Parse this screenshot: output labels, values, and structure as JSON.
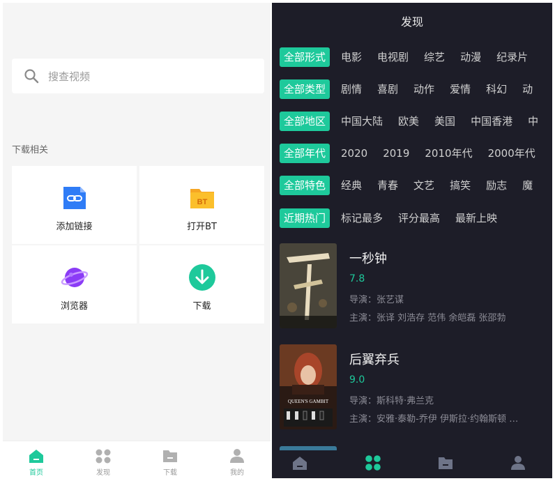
{
  "left": {
    "search": {
      "placeholder": "搜查视频"
    },
    "section_title": "下载相关",
    "tools": [
      {
        "label": "添加链接",
        "icon": "link-icon"
      },
      {
        "label": "打开BT",
        "icon": "bt-folder-icon"
      },
      {
        "label": "浏览器",
        "icon": "planet-icon"
      },
      {
        "label": "下载",
        "icon": "download-icon"
      }
    ],
    "tabs": [
      {
        "label": "首页",
        "icon": "home-icon",
        "active": true
      },
      {
        "label": "发现",
        "icon": "grid-icon",
        "active": false
      },
      {
        "label": "下载",
        "icon": "folder-icon",
        "active": false
      },
      {
        "label": "我的",
        "icon": "user-icon",
        "active": false
      }
    ],
    "accent": "#1ec99b"
  },
  "right": {
    "title": "发现",
    "filters": [
      {
        "selected": "全部形式",
        "options": [
          "电影",
          "电视剧",
          "综艺",
          "动漫",
          "纪录片"
        ]
      },
      {
        "selected": "全部类型",
        "options": [
          "剧情",
          "喜剧",
          "动作",
          "爱情",
          "科幻",
          "动"
        ]
      },
      {
        "selected": "全部地区",
        "options": [
          "中国大陆",
          "欧美",
          "美国",
          "中国香港",
          "中"
        ]
      },
      {
        "selected": "全部年代",
        "options": [
          "2020",
          "2019",
          "2010年代",
          "2000年代"
        ]
      },
      {
        "selected": "全部特色",
        "options": [
          "经典",
          "青春",
          "文艺",
          "搞笑",
          "励志",
          "魔"
        ]
      },
      {
        "selected": "近期热门",
        "options": [
          "标记最多",
          "评分最高",
          "最新上映"
        ]
      }
    ],
    "movies": [
      {
        "title": "一秒钟",
        "score": "7.8",
        "director": "导演：张艺谋",
        "cast": "主演：张译 刘浩存 范伟 余皑磊 张邵勃"
      },
      {
        "title": "后翼弃兵",
        "score": "9.0",
        "director": "导演：斯科特·弗兰克",
        "cast": "主演：安雅·泰勒-乔伊 伊斯拉·约翰斯顿 …"
      }
    ],
    "poster_texts": [
      "QUEEN'S GAMBIT"
    ],
    "tabs": [
      {
        "icon": "home-icon",
        "active": false
      },
      {
        "icon": "grid-icon",
        "active": true
      },
      {
        "icon": "folder-icon",
        "active": false
      },
      {
        "icon": "user-icon",
        "active": false
      }
    ],
    "accent": "#1ec99b",
    "background": "#1d1d28"
  }
}
